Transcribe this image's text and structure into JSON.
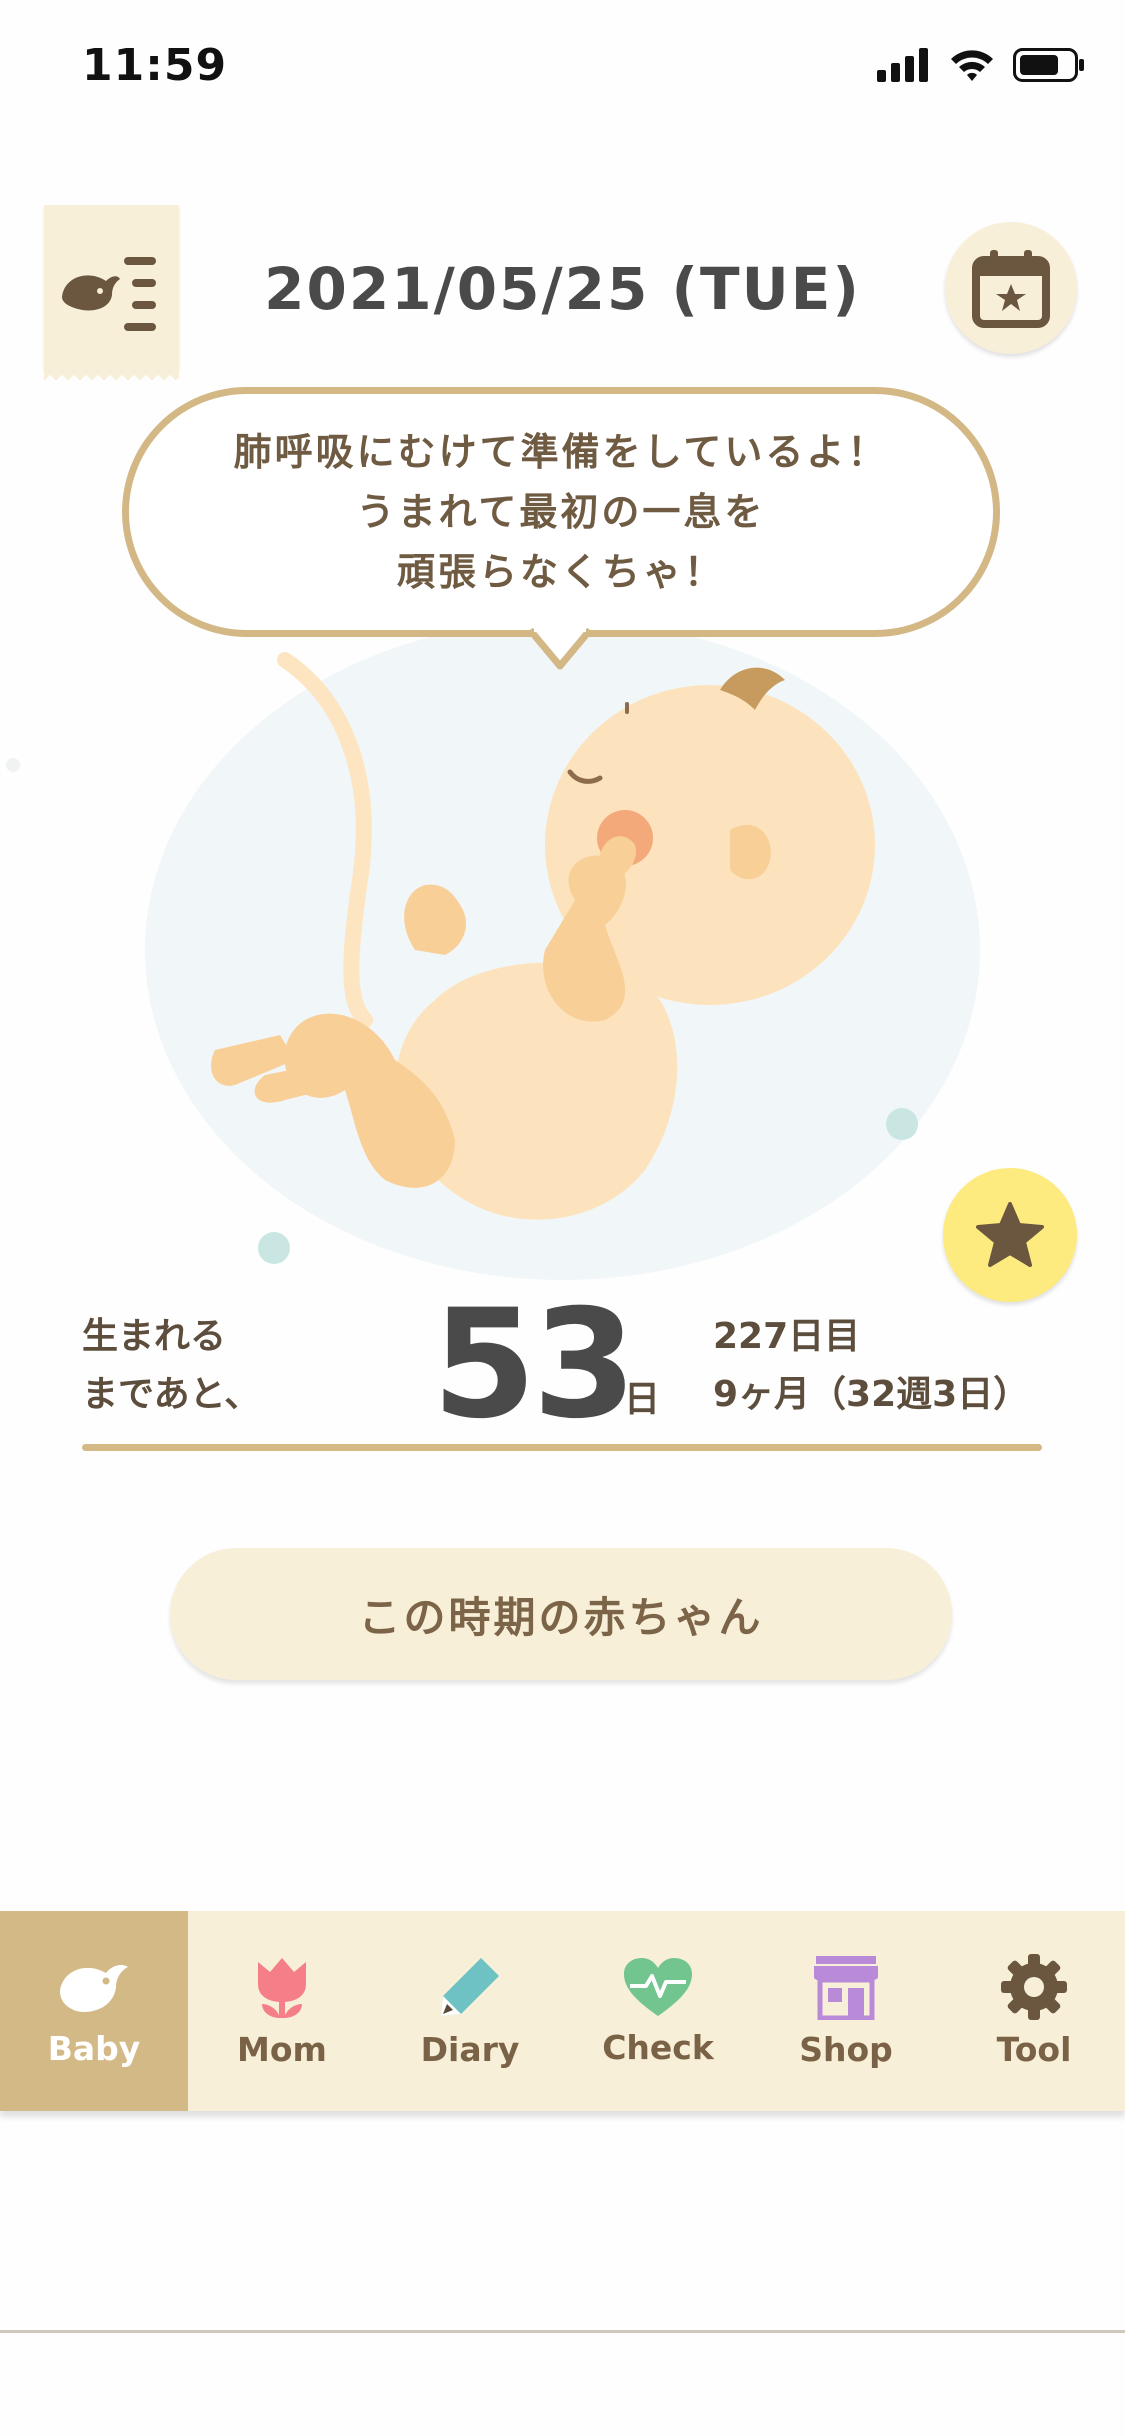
{
  "status_bar": {
    "time": "11:59",
    "icons": [
      "signal-icon",
      "wifi-icon",
      "battery-icon"
    ]
  },
  "header": {
    "menu_icon": "bird-menu-icon",
    "date": "2021/05/25 (TUE)",
    "calendar_icon": "calendar-star-icon"
  },
  "bubble": {
    "lines": [
      "肺呼吸にむけて準備をしているよ！",
      "うまれて最初の一息を",
      "頑張らなくちゃ！"
    ]
  },
  "countdown": {
    "label_line1": "生まれる",
    "label_line2": "まであと、",
    "days": "53",
    "days_unit": "日",
    "day_index": "227日目",
    "month_week": "9ヶ月（32週3日）"
  },
  "favorite_icon": "star-icon",
  "cta": {
    "label": "この時期の赤ちゃん"
  },
  "tabs": [
    {
      "label": "Baby",
      "icon": "bird-icon",
      "active": true
    },
    {
      "label": "Mom",
      "icon": "tulip-icon",
      "active": false
    },
    {
      "label": "Diary",
      "icon": "pencil-icon",
      "active": false
    },
    {
      "label": "Check",
      "icon": "heart-pulse-icon",
      "active": false
    },
    {
      "label": "Shop",
      "icon": "shop-icon",
      "active": false
    },
    {
      "label": "Tool",
      "icon": "gear-icon",
      "active": false
    }
  ],
  "colors": {
    "accent": "#d3b985",
    "panel": "#f8efd9",
    "text": "#5c4d3c",
    "star_button": "#fdeb7f",
    "mom_icon": "#f47f89",
    "diary_icon": "#6fc2c3",
    "check_icon": "#72c58f",
    "shop_icon": "#b98ad8"
  }
}
